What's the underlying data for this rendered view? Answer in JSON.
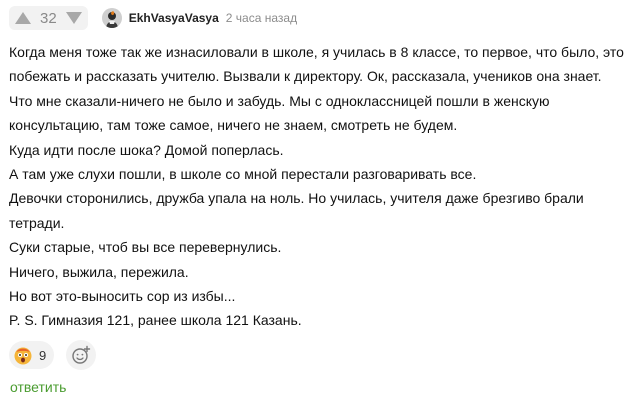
{
  "comment": {
    "score": "32",
    "username": "EkhVasyaVasya",
    "time": "2 часа назад",
    "lines": [
      "Когда меня тоже так же изнасиловали в школе, я училась в 8 классе, то первое, что было, это",
      "побежать и рассказать учителю. Вызвали к директору. Ок, рассказала, учеников она знает.",
      "Что мне сказали-ничего не было и забудь. Мы с одноклассницей пошли в женскую",
      "консультацию, там тоже самое, ничего не знаем, смотреть не будем.",
      "Куда идти после шока? Домой поперлась.",
      "А там уже слухи пошли, в школе со мной перестали разговаривать все.",
      "Девочки сторонились, дружба упала на ноль. Но училась, учителя даже брезгиво брали",
      "тетради.",
      "Суки старые, чтоб вы все перевернулись.",
      "Ничего, выжила, пережила.",
      "Но вот это-выносить сор из избы...",
      "P. S. Гимназия 121, ранее школа 121 Казань."
    ],
    "reactions": [
      {
        "icon": "shocked-face-icon",
        "count": "9"
      }
    ],
    "reply_label": "ответить"
  },
  "colors": {
    "reply_link": "#4a9c30",
    "vote_arrow": "#a8a8a8",
    "pill_background": "#f2f2f2"
  }
}
